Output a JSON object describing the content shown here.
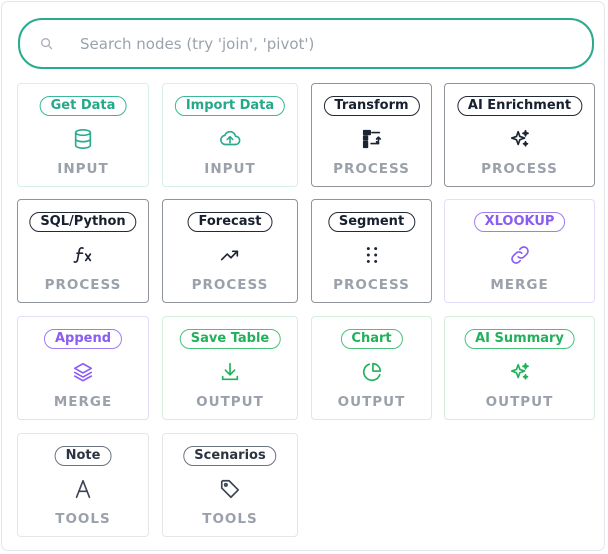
{
  "search": {
    "placeholder": "Search nodes (try 'join', 'pivot')",
    "value": ""
  },
  "nodes": [
    {
      "label": "Get Data",
      "category": "INPUT",
      "icon": "database-icon"
    },
    {
      "label": "Import Data",
      "category": "INPUT",
      "icon": "cloud-upload-icon"
    },
    {
      "label": "Transform",
      "category": "PROCESS",
      "icon": "transform-icon"
    },
    {
      "label": "AI Enrichment",
      "category": "PROCESS",
      "icon": "sparkles-icon"
    },
    {
      "label": "SQL/Python",
      "category": "PROCESS",
      "icon": "function-icon"
    },
    {
      "label": "Forecast",
      "category": "PROCESS",
      "icon": "trending-up-icon"
    },
    {
      "label": "Segment",
      "category": "PROCESS",
      "icon": "grip-dots-icon"
    },
    {
      "label": "XLOOKUP",
      "category": "MERGE",
      "icon": "link-icon"
    },
    {
      "label": "Append",
      "category": "MERGE",
      "icon": "layers-icon"
    },
    {
      "label": "Save Table",
      "category": "OUTPUT",
      "icon": "download-icon"
    },
    {
      "label": "Chart",
      "category": "OUTPUT",
      "icon": "pie-chart-icon"
    },
    {
      "label": "AI Summary",
      "category": "OUTPUT",
      "icon": "sparkles-icon"
    },
    {
      "label": "Note",
      "category": "TOOLS",
      "icon": "text-icon"
    },
    {
      "label": "Scenarios",
      "category": "TOOLS",
      "icon": "tag-icon"
    }
  ],
  "colors": {
    "input": "#2aab8f",
    "process": "#1d2533",
    "merge": "#8b5cf6",
    "output": "#22b15a",
    "tools": "#3b4452"
  }
}
